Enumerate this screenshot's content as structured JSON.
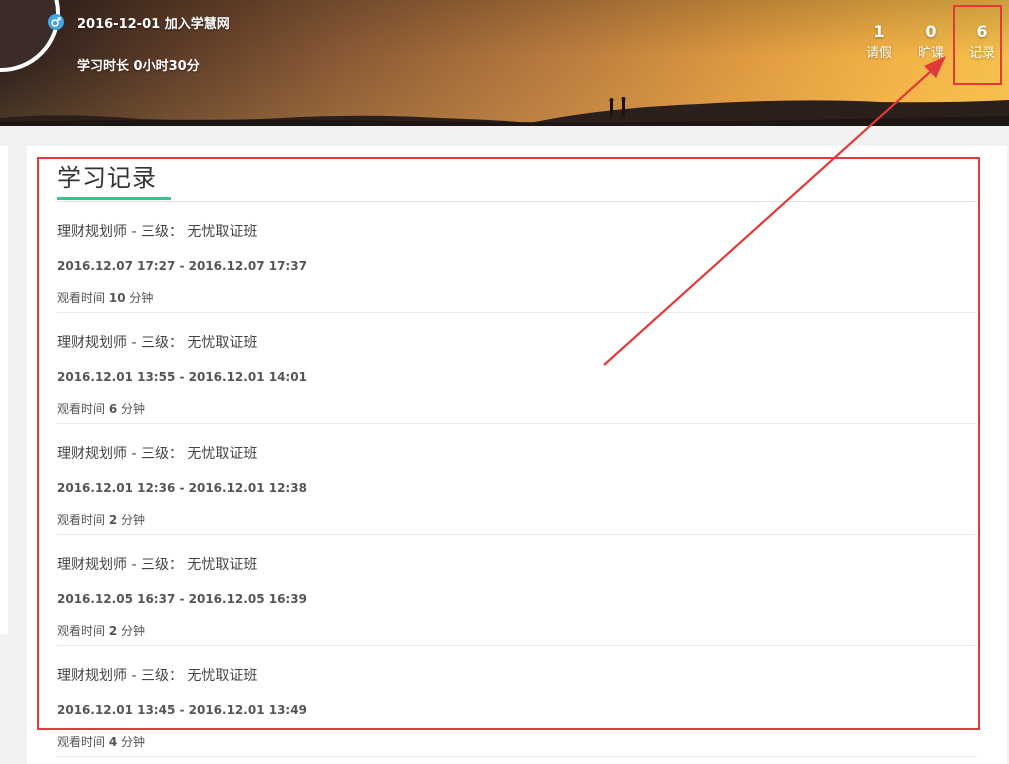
{
  "profile": {
    "joined_date": "2016-12-01",
    "joined_label": "加入学慧网",
    "study_prefix": "学习时长",
    "study_hours": "0",
    "study_hours_unit": "小时",
    "study_minutes": "30",
    "study_minutes_unit": "分"
  },
  "stats": [
    {
      "value": "1",
      "label": "请假"
    },
    {
      "value": "0",
      "label": "旷课"
    },
    {
      "value": "6",
      "label": "记录"
    }
  ],
  "section": {
    "title": "学习记录"
  },
  "records": [
    {
      "course": "理财规划师 - 三级： 无忧取证班",
      "time": "2016.12.07 17:27 - 2016.12.07 17:37",
      "watch_label": "观看时间",
      "watch_value": "10",
      "watch_unit": "分钟"
    },
    {
      "course": "理财规划师 - 三级： 无忧取证班",
      "time": "2016.12.01 13:55 - 2016.12.01 14:01",
      "watch_label": "观看时间",
      "watch_value": "6",
      "watch_unit": "分钟"
    },
    {
      "course": "理财规划师 - 三级： 无忧取证班",
      "time": "2016.12.01 12:36 - 2016.12.01 12:38",
      "watch_label": "观看时间",
      "watch_value": "2",
      "watch_unit": "分钟"
    },
    {
      "course": "理财规划师 - 三级： 无忧取证班",
      "time": "2016.12.05 16:37 - 2016.12.05 16:39",
      "watch_label": "观看时间",
      "watch_value": "2",
      "watch_unit": "分钟"
    },
    {
      "course": "理财规划师 - 三级： 无忧取证班",
      "time": "2016.12.01 13:45 - 2016.12.01 13:49",
      "watch_label": "观看时间",
      "watch_value": "4",
      "watch_unit": "分钟"
    }
  ],
  "colors": {
    "accent_underline": "#3ec28d",
    "annotation_red": "#e03a3a",
    "gender_icon": "#41a6e8"
  },
  "icons": {
    "gender": "male-symbol-icon"
  }
}
